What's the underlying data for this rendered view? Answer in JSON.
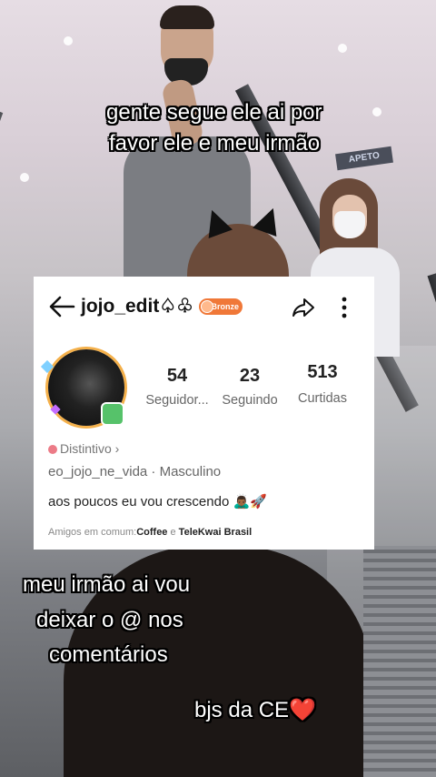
{
  "captions": {
    "line1": "gente segue ele ai por",
    "line2": "favor ele e meu irmão",
    "line3": "meu irmão ai vou",
    "line4": "deixar o @ nos",
    "line5": "comentários",
    "line6": "bjs da CE❤️"
  },
  "store_sign": "APETO",
  "profile": {
    "username": "jojo_edit♤♧",
    "level_badge": "Bronze",
    "stats": [
      {
        "value": "54",
        "label": "Seguidor..."
      },
      {
        "value": "23",
        "label": "Seguindo"
      },
      {
        "value": "513",
        "label": "Curtidas"
      }
    ],
    "badge_label": "Distintivo",
    "handle_gender": "eo_jojo_ne_vida · Masculino",
    "bio": "aos poucos eu vou crescendo 🙇🏾‍♂️🚀",
    "mutual_prefix": "Amigos em comum:",
    "mutual_friend_1": "Coffee",
    "mutual_joiner": " e ",
    "mutual_friend_2": "TeleKwai Brasil"
  },
  "colors": {
    "badge": "#f07838",
    "avatar_ring": "#f4b04a",
    "caption_text": "#ffffff",
    "caption_outline": "#000000"
  }
}
